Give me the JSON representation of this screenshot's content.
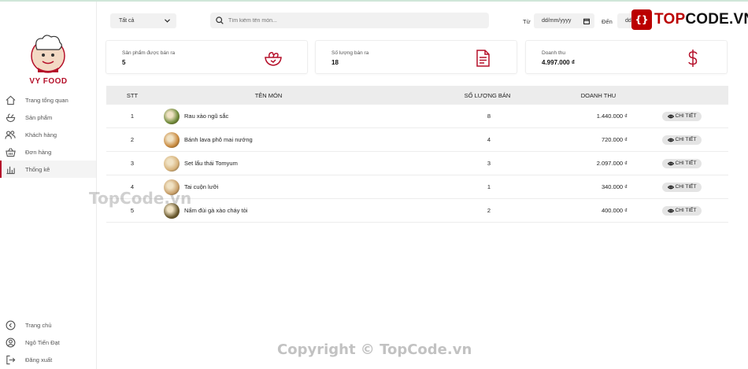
{
  "sidebar": {
    "brand": "VY FOOD",
    "nav": [
      {
        "label": "Trang tổng quan",
        "icon": "home-icon"
      },
      {
        "label": "Sản phẩm",
        "icon": "bowl-icon"
      },
      {
        "label": "Khách hàng",
        "icon": "users-icon"
      },
      {
        "label": "Đơn hàng",
        "icon": "basket-icon"
      },
      {
        "label": "Thống kê",
        "icon": "bar-chart-icon",
        "active": true
      }
    ],
    "footer": [
      {
        "label": "Trang chủ",
        "icon": "back-icon"
      },
      {
        "label": "Ngô Tiến Đạt",
        "icon": "user-icon"
      },
      {
        "label": "Đăng xuất",
        "icon": "logout-icon"
      }
    ]
  },
  "toolbar": {
    "category_value": "Tất cả",
    "search_placeholder": "Tìm kiếm tên món...",
    "from_label": "Từ",
    "from_value": "dd/mm/yyyy",
    "to_label": "Đến",
    "to_value": "dd"
  },
  "cards": [
    {
      "title": "Sản phẩm được bán ra",
      "value": "5",
      "icon": "salad-bowl-icon"
    },
    {
      "title": "Số lượng bán ra",
      "value": "18",
      "icon": "document-icon"
    },
    {
      "title": "Doanh thu",
      "value": "4.997.000 ₫",
      "icon": "dollar-icon"
    }
  ],
  "table": {
    "headers": {
      "stt": "STT",
      "name": "TÊN MÓN",
      "qty": "SỐ LƯỢNG BÁN",
      "revenue": "DOANH THU"
    },
    "action_label": "CHI TIẾT",
    "rows": [
      {
        "stt": "1",
        "name": "Rau xào ngũ sắc",
        "qty": "8",
        "revenue": "1.440.000 ₫",
        "thumb_color": "#6f8a3a"
      },
      {
        "stt": "2",
        "name": "Bánh lava phô mai nướng",
        "qty": "4",
        "revenue": "720.000 ₫",
        "thumb_color": "#c98a3f"
      },
      {
        "stt": "3",
        "name": "Set lẩu thái Tomyum",
        "qty": "3",
        "revenue": "2.097.000 ₫",
        "thumb_color": "#d7b27a"
      },
      {
        "stt": "4",
        "name": "Tai cuộn lưỡi",
        "qty": "1",
        "revenue": "340.000 ₫",
        "thumb_color": "#c9a06a"
      },
      {
        "stt": "5",
        "name": "Nấm đùi gà xào cháy tỏi",
        "qty": "2",
        "revenue": "400.000 ₫",
        "thumb_color": "#6a5a2f"
      }
    ]
  },
  "watermarks": {
    "logo_left": "TOP",
    "logo_right": "CODE.VN",
    "middle": "TopCode.vn",
    "bottom": "Copyright © TopCode.vn"
  },
  "colors": {
    "accent": "#b5102a",
    "surface": "#f1f1f1"
  }
}
